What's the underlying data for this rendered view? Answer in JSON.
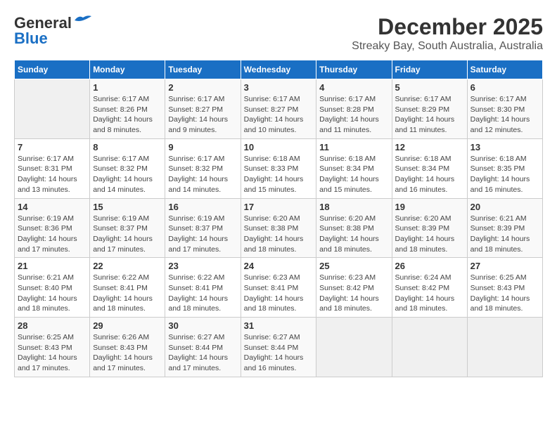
{
  "logo": {
    "general": "General",
    "blue": "Blue"
  },
  "title": "December 2025",
  "subtitle": "Streaky Bay, South Australia, Australia",
  "headers": [
    "Sunday",
    "Monday",
    "Tuesday",
    "Wednesday",
    "Thursday",
    "Friday",
    "Saturday"
  ],
  "weeks": [
    [
      {
        "day": "",
        "info": ""
      },
      {
        "day": "1",
        "info": "Sunrise: 6:17 AM\nSunset: 8:26 PM\nDaylight: 14 hours\nand 8 minutes."
      },
      {
        "day": "2",
        "info": "Sunrise: 6:17 AM\nSunset: 8:27 PM\nDaylight: 14 hours\nand 9 minutes."
      },
      {
        "day": "3",
        "info": "Sunrise: 6:17 AM\nSunset: 8:27 PM\nDaylight: 14 hours\nand 10 minutes."
      },
      {
        "day": "4",
        "info": "Sunrise: 6:17 AM\nSunset: 8:28 PM\nDaylight: 14 hours\nand 11 minutes."
      },
      {
        "day": "5",
        "info": "Sunrise: 6:17 AM\nSunset: 8:29 PM\nDaylight: 14 hours\nand 11 minutes."
      },
      {
        "day": "6",
        "info": "Sunrise: 6:17 AM\nSunset: 8:30 PM\nDaylight: 14 hours\nand 12 minutes."
      }
    ],
    [
      {
        "day": "7",
        "info": "Sunrise: 6:17 AM\nSunset: 8:31 PM\nDaylight: 14 hours\nand 13 minutes."
      },
      {
        "day": "8",
        "info": "Sunrise: 6:17 AM\nSunset: 8:32 PM\nDaylight: 14 hours\nand 14 minutes."
      },
      {
        "day": "9",
        "info": "Sunrise: 6:17 AM\nSunset: 8:32 PM\nDaylight: 14 hours\nand 14 minutes."
      },
      {
        "day": "10",
        "info": "Sunrise: 6:18 AM\nSunset: 8:33 PM\nDaylight: 14 hours\nand 15 minutes."
      },
      {
        "day": "11",
        "info": "Sunrise: 6:18 AM\nSunset: 8:34 PM\nDaylight: 14 hours\nand 15 minutes."
      },
      {
        "day": "12",
        "info": "Sunrise: 6:18 AM\nSunset: 8:34 PM\nDaylight: 14 hours\nand 16 minutes."
      },
      {
        "day": "13",
        "info": "Sunrise: 6:18 AM\nSunset: 8:35 PM\nDaylight: 14 hours\nand 16 minutes."
      }
    ],
    [
      {
        "day": "14",
        "info": "Sunrise: 6:19 AM\nSunset: 8:36 PM\nDaylight: 14 hours\nand 17 minutes."
      },
      {
        "day": "15",
        "info": "Sunrise: 6:19 AM\nSunset: 8:37 PM\nDaylight: 14 hours\nand 17 minutes."
      },
      {
        "day": "16",
        "info": "Sunrise: 6:19 AM\nSunset: 8:37 PM\nDaylight: 14 hours\nand 17 minutes."
      },
      {
        "day": "17",
        "info": "Sunrise: 6:20 AM\nSunset: 8:38 PM\nDaylight: 14 hours\nand 18 minutes."
      },
      {
        "day": "18",
        "info": "Sunrise: 6:20 AM\nSunset: 8:38 PM\nDaylight: 14 hours\nand 18 minutes."
      },
      {
        "day": "19",
        "info": "Sunrise: 6:20 AM\nSunset: 8:39 PM\nDaylight: 14 hours\nand 18 minutes."
      },
      {
        "day": "20",
        "info": "Sunrise: 6:21 AM\nSunset: 8:39 PM\nDaylight: 14 hours\nand 18 minutes."
      }
    ],
    [
      {
        "day": "21",
        "info": "Sunrise: 6:21 AM\nSunset: 8:40 PM\nDaylight: 14 hours\nand 18 minutes."
      },
      {
        "day": "22",
        "info": "Sunrise: 6:22 AM\nSunset: 8:41 PM\nDaylight: 14 hours\nand 18 minutes."
      },
      {
        "day": "23",
        "info": "Sunrise: 6:22 AM\nSunset: 8:41 PM\nDaylight: 14 hours\nand 18 minutes."
      },
      {
        "day": "24",
        "info": "Sunrise: 6:23 AM\nSunset: 8:41 PM\nDaylight: 14 hours\nand 18 minutes."
      },
      {
        "day": "25",
        "info": "Sunrise: 6:23 AM\nSunset: 8:42 PM\nDaylight: 14 hours\nand 18 minutes."
      },
      {
        "day": "26",
        "info": "Sunrise: 6:24 AM\nSunset: 8:42 PM\nDaylight: 14 hours\nand 18 minutes."
      },
      {
        "day": "27",
        "info": "Sunrise: 6:25 AM\nSunset: 8:43 PM\nDaylight: 14 hours\nand 18 minutes."
      }
    ],
    [
      {
        "day": "28",
        "info": "Sunrise: 6:25 AM\nSunset: 8:43 PM\nDaylight: 14 hours\nand 17 minutes."
      },
      {
        "day": "29",
        "info": "Sunrise: 6:26 AM\nSunset: 8:43 PM\nDaylight: 14 hours\nand 17 minutes."
      },
      {
        "day": "30",
        "info": "Sunrise: 6:27 AM\nSunset: 8:44 PM\nDaylight: 14 hours\nand 17 minutes."
      },
      {
        "day": "31",
        "info": "Sunrise: 6:27 AM\nSunset: 8:44 PM\nDaylight: 14 hours\nand 16 minutes."
      },
      {
        "day": "",
        "info": ""
      },
      {
        "day": "",
        "info": ""
      },
      {
        "day": "",
        "info": ""
      }
    ]
  ]
}
